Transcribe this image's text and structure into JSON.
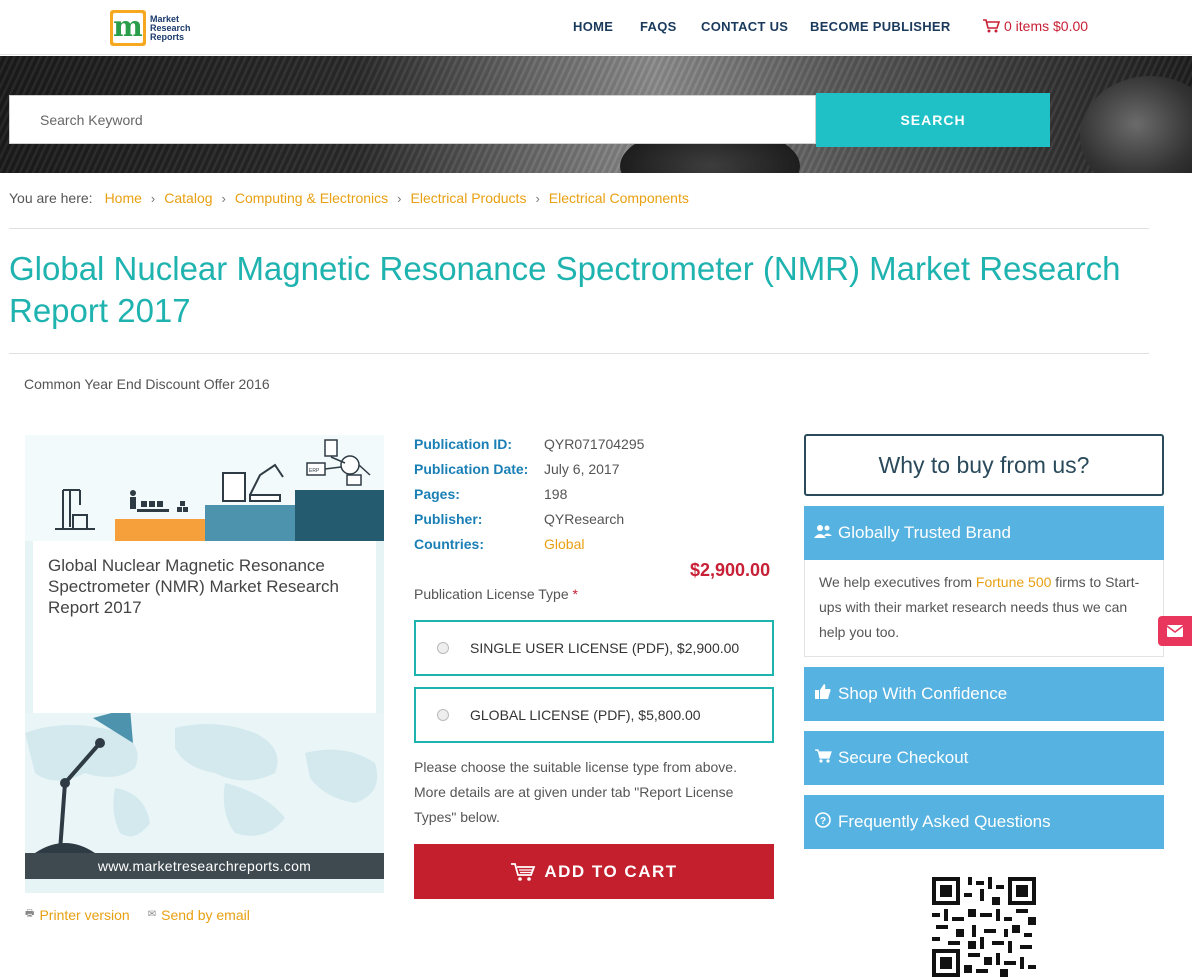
{
  "header": {
    "logo_text": "Market\nResearch\nReports",
    "nav": [
      {
        "label": "HOME"
      },
      {
        "label": "FAQS"
      },
      {
        "label": "CONTACT US"
      },
      {
        "label": "BECOME PUBLISHER"
      }
    ],
    "cart_label": "0 items $0.00"
  },
  "search": {
    "placeholder": "Search Keyword",
    "button_label": "SEARCH"
  },
  "breadcrumb": {
    "label": "You are here:",
    "items": [
      "Home",
      "Catalog",
      "Computing & Electronics",
      "Electrical Products",
      "Electrical Components"
    ]
  },
  "page_title": "Global Nuclear Magnetic Resonance Spectrometer (NMR) Market Research Report 2017",
  "offer_text": "Common Year End Discount Offer 2016",
  "product_image": {
    "title": "Global Nuclear Magnetic Resonance Spectrometer (NMR) Market Research Report 2017",
    "url_text": "www.marketresearchreports.com",
    "erp_label": "ERP"
  },
  "tools": {
    "printer": "Printer version",
    "email": "Send by email"
  },
  "details": [
    {
      "label": "Publication ID:",
      "value": "QYR071704295"
    },
    {
      "label": "Publication Date:",
      "value": "July 6, 2017"
    },
    {
      "label": "Pages:",
      "value": "198"
    },
    {
      "label": "Publisher:",
      "value": "QYResearch"
    },
    {
      "label": "Countries:",
      "value": "Global"
    }
  ],
  "price": "$2,900.00",
  "license": {
    "label": "Publication License Type",
    "required_mark": "*",
    "options": [
      {
        "label": "SINGLE USER LICENSE (PDF), $2,900.00"
      },
      {
        "label": "GLOBAL LICENSE (PDF), $5,800.00"
      }
    ],
    "note": "Please choose the suitable license type from above. More details are at given under tab \"Report License Types\" below."
  },
  "add_to_cart": "ADD TO CART",
  "sidebar": {
    "why_title": "Why to buy from us?",
    "trusted": "Globally Trusted Brand",
    "desc_pre": "We help executives from ",
    "desc_hl": "Fortune 500",
    "desc_post": " firms to Start-ups with their market research needs thus we can help you too.",
    "confidence": "Shop With Confidence",
    "checkout": "Secure Checkout",
    "faq": "Frequently Asked Questions"
  },
  "colors": {
    "teal": "#1fc1c7",
    "title_teal": "#1fb3b0",
    "orange_link": "#e8a012",
    "red": "#c41f2d",
    "blue_label": "#1a7fb5",
    "side_blue": "#56b2e0"
  }
}
